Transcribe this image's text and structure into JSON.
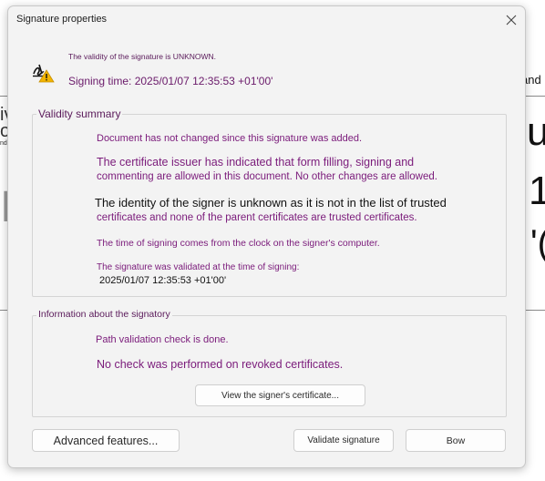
{
  "background": {
    "texts": [
      "and",
      "iv",
      "o",
      "nd",
      "ur",
      "1",
      "'(",
      "I"
    ]
  },
  "dialog": {
    "title": "Signature properties",
    "header": {
      "status": "The validity of the signature is UNKNOWN.",
      "signing_time": "Signing time: 2025/01/07 12:35:53 +01'00'"
    },
    "validity_summary": {
      "label": "Validity summary",
      "doc_unchanged": "Document has not changed since this signature was added.",
      "issuer_line1": "The certificate issuer has indicated that form filling, signing and",
      "issuer_line2": "commenting are allowed in this document. No other changes are allowed.",
      "identity_line1": "The identity of the signer is unknown as it is not in the list of trusted",
      "identity_line2": "certificates and none of the parent certificates are trusted certificates.",
      "time_source": "The time of signing comes from the clock on the signer's computer.",
      "validated_line1": "The signature was validated at the time of signing:",
      "validated_line2": "2025/01/07 12:35:53 +01'00'"
    },
    "signatory_info": {
      "label": "Information about the signatory",
      "path_check": "Path validation check is done.",
      "revocation": "No check was performed on revoked certificates.",
      "view_cert_button": "View the signer's certificate..."
    },
    "buttons": {
      "advanced": "Advanced features...",
      "validate": "Validate signature",
      "close": "Bow"
    }
  }
}
